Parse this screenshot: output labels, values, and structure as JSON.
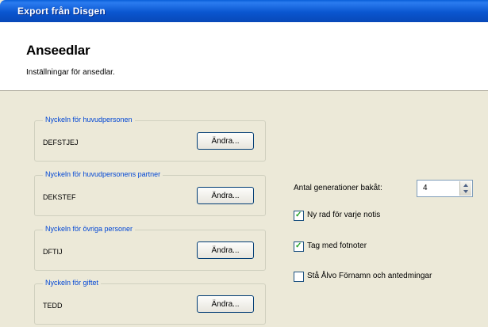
{
  "window": {
    "title": "Export från Disgen"
  },
  "header": {
    "title": "Anseedlar",
    "subtitle": "Inställningar för ansedlar."
  },
  "groups": [
    {
      "label": "Nyckeln för huvudpersonen",
      "value": "DEFSTJEJ",
      "button": "Ändra..."
    },
    {
      "label": "Nyckeln för huvudpersonens partner",
      "value": "DEKSTEF",
      "button": "Ändra..."
    },
    {
      "label": "Nyckeln för övriga personer",
      "value": "DFTIJ",
      "button": "Ändra..."
    },
    {
      "label": "Nyckeln för giftet",
      "value": "TEDD",
      "button": "Ändra..."
    }
  ],
  "generations": {
    "label": "Antal generationer bakåt:",
    "value": "4"
  },
  "checkboxes": [
    {
      "label": "Ny rad för varje notis",
      "checked": true
    },
    {
      "label": "Tag med fotnoter",
      "checked": true
    },
    {
      "label": "Stå Ålvo Förnamn och antedmingar",
      "checked": false
    }
  ]
}
